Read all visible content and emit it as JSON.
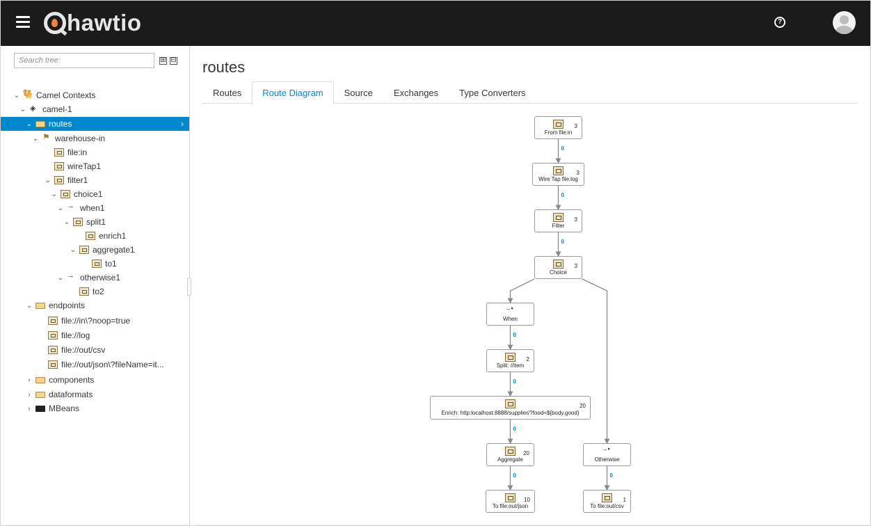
{
  "header": {
    "app_name": "hawtio",
    "help_icon": "help-icon",
    "avatar_icon": "user-avatar-icon"
  },
  "sidebar": {
    "search_placeholder": "Search tree:",
    "expand_all": "⊞",
    "collapse_all": "⊟",
    "tree": [
      {
        "label": "Camel Contexts",
        "icon": "camel-icon",
        "expanded": true
      },
      {
        "label": "camel-1",
        "icon": "cube-icon",
        "expanded": true
      },
      {
        "label": "routes",
        "icon": "folder-icon",
        "expanded": true,
        "selected": true
      },
      {
        "label": "warehouse-in",
        "icon": "route-icon",
        "expanded": true
      },
      {
        "label": "file:in",
        "icon": "endpoint-icon"
      },
      {
        "label": "wireTap1",
        "icon": "wiretap-icon"
      },
      {
        "label": "filter1",
        "icon": "filter-icon",
        "expanded": true
      },
      {
        "label": "choice1",
        "icon": "choice-icon",
        "expanded": true
      },
      {
        "label": "when1",
        "icon": "when-icon",
        "expanded": true
      },
      {
        "label": "split1",
        "icon": "split-icon",
        "expanded": true
      },
      {
        "label": "enrich1",
        "icon": "enrich-icon"
      },
      {
        "label": "aggregate1",
        "icon": "aggregate-icon",
        "expanded": true
      },
      {
        "label": "to1",
        "icon": "to-icon"
      },
      {
        "label": "otherwise1",
        "icon": "otherwise-icon",
        "expanded": true
      },
      {
        "label": "to2",
        "icon": "to-icon"
      },
      {
        "label": "endpoints",
        "icon": "folder-icon",
        "expanded": true
      },
      {
        "label": "file://in\\?noop=true",
        "icon": "endpoint-icon"
      },
      {
        "label": "file://log",
        "icon": "endpoint-icon"
      },
      {
        "label": "file://out/csv",
        "icon": "endpoint-icon"
      },
      {
        "label": "file://out/json\\?fileName=it...",
        "icon": "endpoint-icon"
      },
      {
        "label": "components",
        "icon": "folder-icon",
        "expanded": false
      },
      {
        "label": "dataformats",
        "icon": "folder-icon",
        "expanded": false
      },
      {
        "label": "MBeans",
        "icon": "folder-dark-icon",
        "expanded": false
      }
    ]
  },
  "main": {
    "title": "routes",
    "tabs": [
      {
        "label": "Routes",
        "active": false
      },
      {
        "label": "Route Diagram",
        "active": true
      },
      {
        "label": "Source",
        "active": false
      },
      {
        "label": "Exchanges",
        "active": false
      },
      {
        "label": "Type Converters",
        "active": false
      }
    ]
  },
  "diagram": {
    "nodes": [
      {
        "id": "from",
        "label": "From file:in",
        "count": "3",
        "icon": "endpoint-icon"
      },
      {
        "id": "wiretap",
        "label": "Wire Tap file:log",
        "count": "3",
        "icon": "wiretap-icon"
      },
      {
        "id": "filter",
        "label": "Filter",
        "count": "3",
        "icon": "filter-icon"
      },
      {
        "id": "choice",
        "label": "Choice",
        "count": "3",
        "icon": "choice-icon"
      },
      {
        "id": "when",
        "label": "When",
        "count": "",
        "icon": "when-icon"
      },
      {
        "id": "split",
        "label": "Split: //item",
        "count": "2",
        "icon": "split-icon"
      },
      {
        "id": "enrich",
        "label": "Enrich: http:localhost:8888/supplier/?food=${body.good}",
        "count": "20",
        "icon": "enrich-icon"
      },
      {
        "id": "aggregate",
        "label": "Aggregate",
        "count": "20",
        "icon": "aggregate-icon"
      },
      {
        "id": "tojson",
        "label": "To file:out/json",
        "count": "10",
        "icon": "to-icon"
      },
      {
        "id": "otherwise",
        "label": "Otherwise",
        "count": "",
        "icon": "otherwise-icon"
      },
      {
        "id": "tocsv",
        "label": "To file:out/csv",
        "count": "1",
        "icon": "to-icon"
      }
    ],
    "edges": [
      {
        "from": "from",
        "to": "wiretap",
        "label": "0"
      },
      {
        "from": "wiretap",
        "to": "filter",
        "label": "0"
      },
      {
        "from": "filter",
        "to": "choice",
        "label": "0"
      },
      {
        "from": "choice",
        "to": "when",
        "label": ""
      },
      {
        "from": "when",
        "to": "split",
        "label": "0"
      },
      {
        "from": "split",
        "to": "enrich",
        "label": "0"
      },
      {
        "from": "enrich",
        "to": "aggregate",
        "label": "0"
      },
      {
        "from": "aggregate",
        "to": "tojson",
        "label": "0"
      },
      {
        "from": "choice",
        "to": "otherwise",
        "label": ""
      },
      {
        "from": "otherwise",
        "to": "tocsv",
        "label": "0"
      }
    ]
  }
}
